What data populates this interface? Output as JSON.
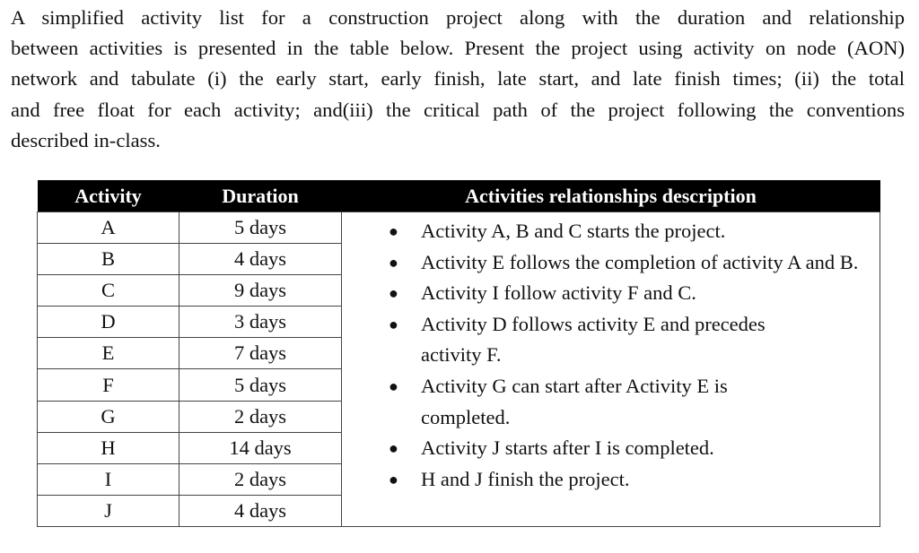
{
  "question": {
    "lines": [
      "A simplified activity list for a construction project along with the duration and relationship",
      "between activities is presented in the table below. Present the project using activity on node (AON)",
      "network and tabulate (i) the early start, early finish, late start, and late finish times; (ii) the total",
      "and free float for each activity; and(iii) the critical path of the project following the conventions",
      "described in-class."
    ]
  },
  "table": {
    "headers": [
      "Activity",
      "Duration",
      "Activities relationships description"
    ],
    "rows": [
      {
        "activity": "A",
        "duration": "5 days"
      },
      {
        "activity": "B",
        "duration": "4 days"
      },
      {
        "activity": "C",
        "duration": "9 days"
      },
      {
        "activity": "D",
        "duration": "3 days"
      },
      {
        "activity": "E",
        "duration": "7 days"
      },
      {
        "activity": "F",
        "duration": "5 days"
      },
      {
        "activity": "G",
        "duration": "2 days"
      },
      {
        "activity": "H",
        "duration": "14 days"
      },
      {
        "activity": "I",
        "duration": "2 days"
      },
      {
        "activity": "J",
        "duration": "4 days"
      }
    ],
    "relationships": [
      "Activity A, B and C starts the project.",
      "Activity E follows the completion of activity A and B.",
      "Activity I follow activity F and C.",
      "Activity D follows activity E and precedes activity F.",
      "Activity G can start after Activity E is completed.",
      "Activity J starts after I is completed.",
      "H and J finish the project."
    ],
    "bullet_glyph": "●"
  }
}
